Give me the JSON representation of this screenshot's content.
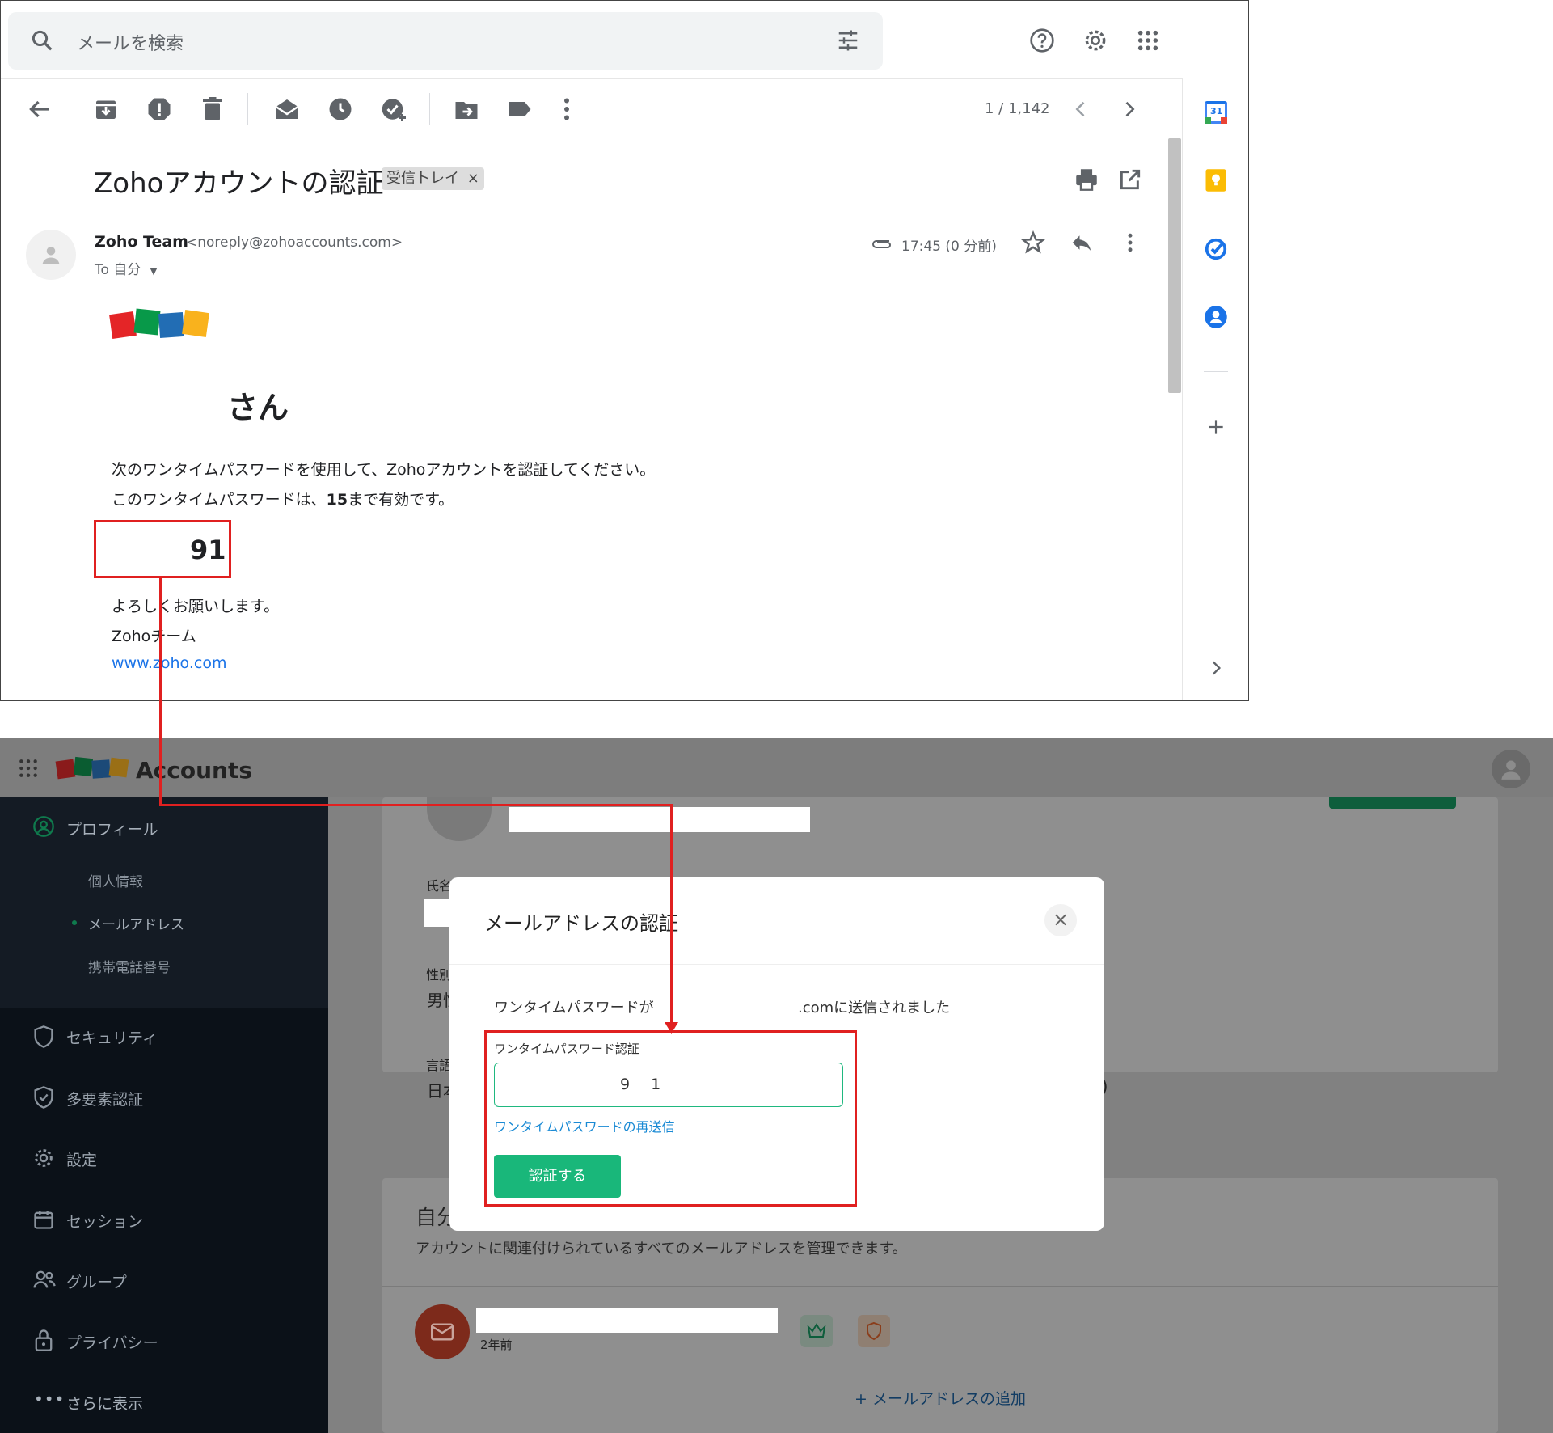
{
  "gmail": {
    "search_placeholder": "メールを検索",
    "pagination": "1 / 1,142",
    "subject": "Zohoアカウントの認証",
    "label_chip": "受信トレイ",
    "label_chip_close": "×",
    "sender_name": "Zoho Team",
    "sender_email": "<noreply@zohoaccounts.com>",
    "to_line": "To 自分",
    "time": "17:45 (0 分前)",
    "greeting": "さん",
    "body_line1": "次のワンタイムパスワードを使用して、Zohoアカウントを認証してください。",
    "body_line2_a": "このワンタイムパスワードは、",
    "body_line2_b": "15",
    "body_line2_c": "まで有効です。",
    "otp_value": "91",
    "closing1": "よろしくお願いします。",
    "closing2": "Zohoチーム",
    "website": "www.zoho.com",
    "calendar_day": "31"
  },
  "zoho": {
    "app_name": "Accounts",
    "sidebar": {
      "profile": "プロフィール",
      "personal_info": "個人情報",
      "email_address": "メールアドレス",
      "mobile_number": "携帯電話番号",
      "security": "セキュリティ",
      "mfa": "多要素認証",
      "settings": "設定",
      "sessions": "セッション",
      "groups": "グループ",
      "privacy": "プライバシー",
      "more": "さらに表示"
    },
    "background": {
      "name_label": "氏名",
      "gender_label": "性別",
      "gender_value": "男性",
      "language_label": "言語",
      "language_value": "日本",
      "paren": ")",
      "section_title": "自分",
      "section_desc": "アカウントに関連付けられているすべてのメールアドレスを管理できます。",
      "email_age": "2年前",
      "add_email": "+ メールアドレスの追加"
    },
    "dialog": {
      "title": "メールアドレスの認証",
      "msg_prefix": "ワンタイムパスワードが",
      "msg_suffix": ".comに送信されました",
      "field_label": "ワンタイムパスワード認証",
      "input_value": "9 1",
      "resend": "ワンタイムパスワードの再送信",
      "verify": "認証する",
      "close": "×"
    }
  },
  "colors": {
    "highlight_red": "#e02020",
    "zoho_green": "#19b77a",
    "link_blue": "#1a73e8"
  }
}
